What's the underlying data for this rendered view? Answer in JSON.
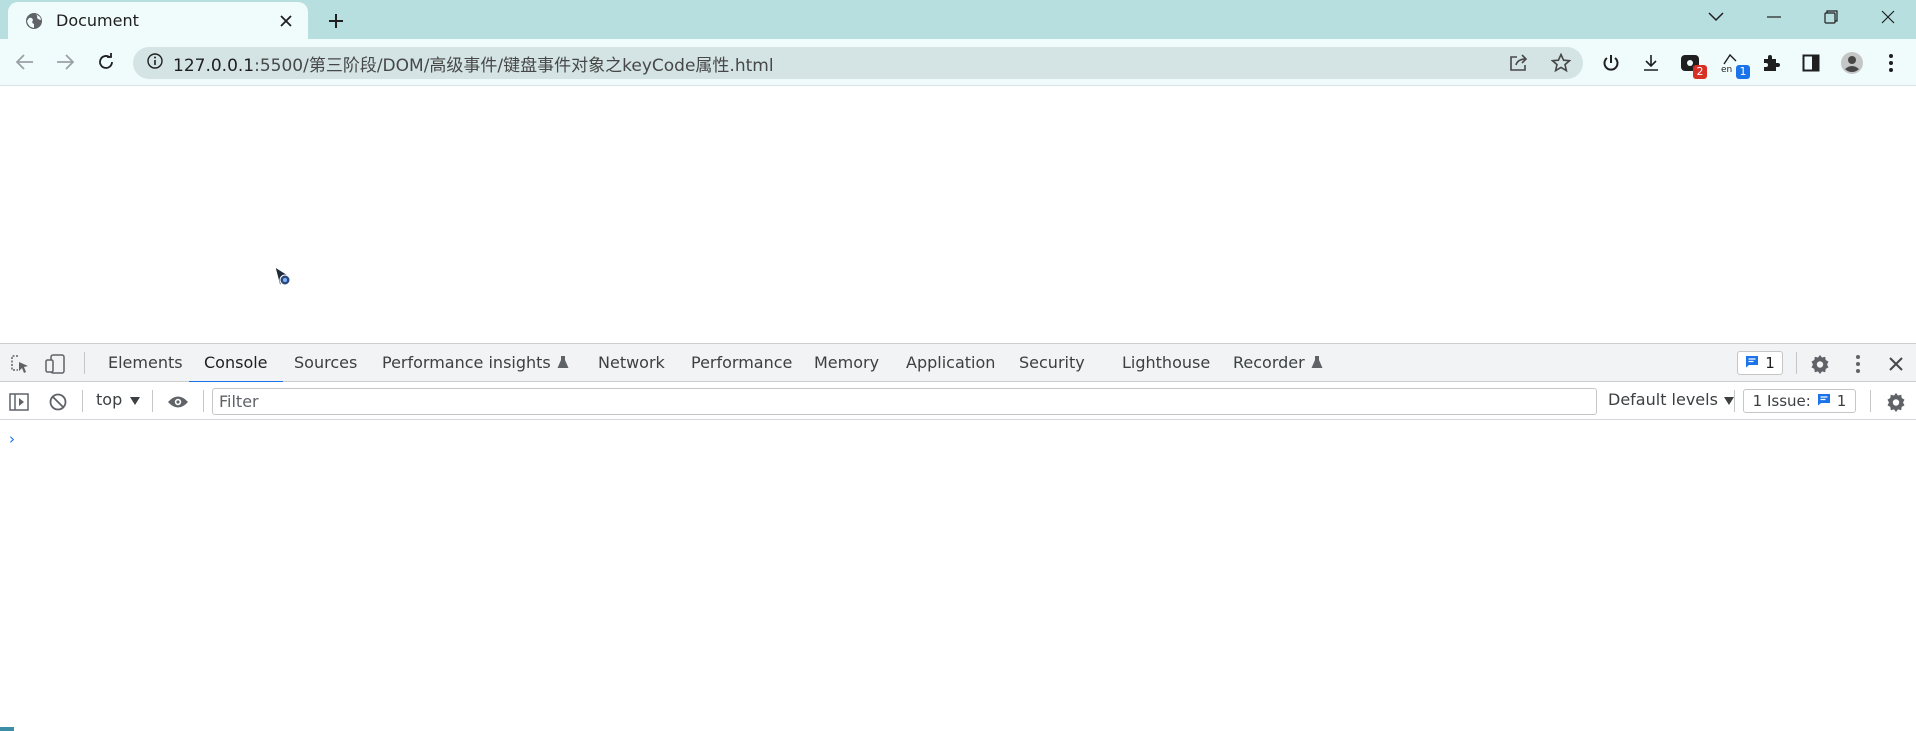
{
  "browser": {
    "tab": {
      "title": "Document",
      "favicon": "globe-icon",
      "close": "close-icon"
    },
    "new_tab": "plus-icon",
    "window_controls": [
      "chevron-down-icon",
      "minimize-icon",
      "restore-icon",
      "close-icon"
    ],
    "toolbar": {
      "back": "arrow-left-icon",
      "forward": "arrow-right-icon",
      "reload": "reload-icon",
      "url_host": "127.0.0.1",
      "url_path": ":5500/第三阶段/DOM/高级事件/键盘事件对象之keyCode属性.html",
      "site_info": "info-icon",
      "share": "share-icon",
      "bookmark": "star-icon"
    },
    "extensions": [
      {
        "name": "power-icon"
      },
      {
        "name": "download-icon"
      },
      {
        "name": "extension-badge-icon",
        "badge": "2",
        "badge_color": "#d93025"
      },
      {
        "name": "translate-icon",
        "badge": "1",
        "badge_color": "#1a73e8",
        "label": "en"
      },
      {
        "name": "puzzle-icon"
      },
      {
        "name": "side-panel-icon"
      },
      {
        "name": "profile-icon"
      },
      {
        "name": "more-vert-icon"
      }
    ]
  },
  "devtools": {
    "tabs": [
      {
        "label": "Elements"
      },
      {
        "label": "Console",
        "active": true
      },
      {
        "label": "Sources"
      },
      {
        "label": "Performance insights",
        "experimental": true
      },
      {
        "label": "Network"
      },
      {
        "label": "Performance"
      },
      {
        "label": "Memory"
      },
      {
        "label": "Application"
      },
      {
        "label": "Security"
      },
      {
        "label": "Lighthouse"
      },
      {
        "label": "Recorder",
        "experimental": true
      }
    ],
    "issues_count": "1",
    "console_bar": {
      "context": "top",
      "filter_placeholder": "Filter",
      "levels": "Default levels",
      "issues_label": "1 Issue:",
      "issues_count": "1"
    },
    "prompt": "›",
    "accent_color": "#1a73e8"
  }
}
